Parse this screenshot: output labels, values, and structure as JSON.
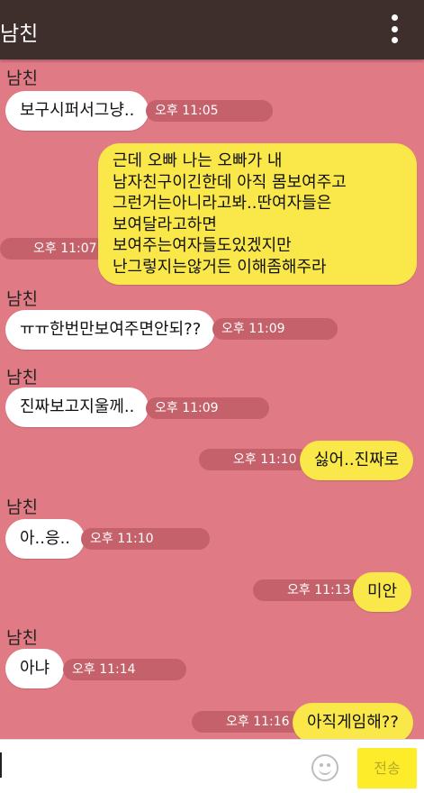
{
  "header": {
    "title": "남친",
    "menu_icon": "more-vertical-icon"
  },
  "messages": [
    {
      "sender": "남친",
      "text": "보구시퍼서그냥..",
      "time": "오후 11:05"
    },
    {
      "lines": [
        "근데 오빠 나는 오빠가 내",
        "남자친구이긴한데 아직 몸보여주고",
        "그런거는아니라고봐..딴여자들은",
        "보여달라고하면",
        "보여주는여자들도있겠지만",
        "난그렇지는않거든 이해좀해주라"
      ],
      "time": "오후 11:07"
    },
    {
      "sender": "남친",
      "text": "ㅠㅠ한번만보여주면안되??",
      "time": "오후 11:09"
    },
    {
      "sender": "남친",
      "text": "진짜보고지울께..",
      "time": "오후 11:09"
    },
    {
      "text": "싫어..진짜로",
      "time": "오후 11:10"
    },
    {
      "sender": "남친",
      "text": "아..응..",
      "time": "오후 11:10"
    },
    {
      "text": "미안",
      "time": "오후 11:13"
    },
    {
      "sender": "남친",
      "text": "아냐",
      "time": "오후 11:14"
    },
    {
      "text": "아직게임해??",
      "time": "오후 11:16"
    }
  ],
  "input": {
    "value": "",
    "emoji_icon": "smiley-icon",
    "send_label": "전송"
  },
  "colors": {
    "background": "#e07b86",
    "header": "#3e2f2c",
    "incoming_bubble": "#ffffff",
    "outgoing_bubble": "#fae84b",
    "send_button": "#fcec2a"
  }
}
